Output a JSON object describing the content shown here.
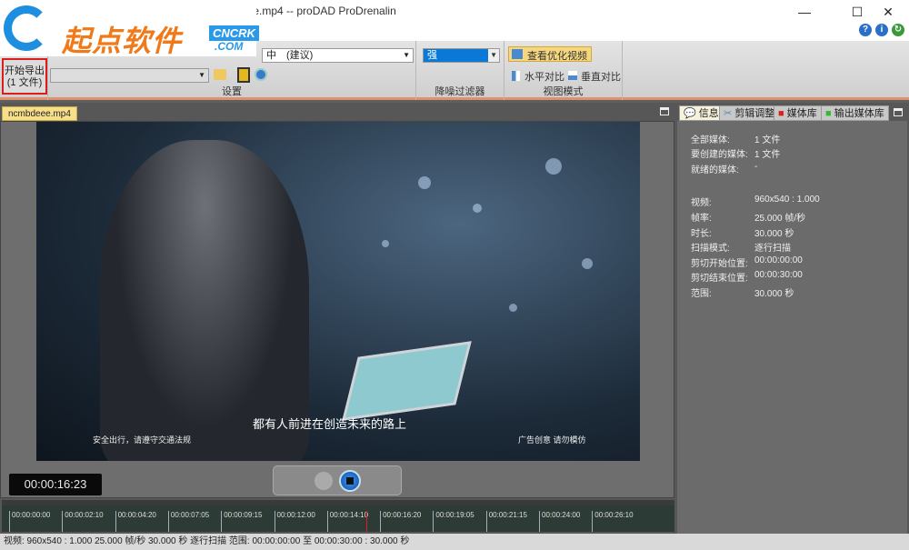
{
  "window": {
    "title": "eee.mp4 -- proDAD ProDrenalin",
    "minimize": "—",
    "maximize": "☐",
    "close": "✕",
    "help": "?",
    "info": "i"
  },
  "watermark": {
    "text": "起点软件",
    "brand": "CNCRK",
    ".com": ".COM"
  },
  "ribbon": {
    "export_label": "开始导出",
    "export_count": "(1 文件)",
    "quality_value": "中　(建议)",
    "path_value": "",
    "settings_label": "设置",
    "denoise_value": "强",
    "denoise_label": "降噪过滤器",
    "view_optimized": "查看优化视频",
    "horizontal": "水平对比",
    "vertical": "垂直对比",
    "view_label": "视图模式"
  },
  "file_tab": "ncmbdeee.mp4",
  "video": {
    "subtitle": "都有人前进在创造未来的路上",
    "left_caption": "安全出行，请遵守交通法规",
    "right_caption": "广告创意 请勿模仿"
  },
  "timecode": "00:00:16:23",
  "timeline": {
    "ticks": [
      "00:00:00:00",
      "00:00:02:10",
      "00:00:04:20",
      "00:00:07:05",
      "00:00:09:15",
      "00:00:12:00",
      "00:00:14:10",
      "00:00:16:20",
      "00:00:19:05",
      "00:00:21:15",
      "00:00:24:00",
      "00:00:26:10"
    ],
    "playhead_fraction": 0.562
  },
  "status": "视频: 960x540 : 1.000   25.000 帧/秒   30.000 秒   逐行扫描   范围: 00:00:00:00 至 00:00:30:00 : 30.000 秒",
  "right_panel": {
    "tabs": [
      "信息",
      "剪辑调整",
      "媒体库",
      "输出媒体库"
    ],
    "rows": [
      {
        "label": "全部媒体:",
        "value": "1 文件"
      },
      {
        "label": "要创建的媒体:",
        "value": "1 文件"
      },
      {
        "label": "就绪的媒体:",
        "value": "-"
      },
      {
        "label": "视频:",
        "value": "960x540 : 1.000"
      },
      {
        "label": "帧率:",
        "value": "25.000 帧/秒"
      },
      {
        "label": "时长:",
        "value": "30.000 秒"
      },
      {
        "label": "扫描模式:",
        "value": "逐行扫描"
      },
      {
        "label": "剪切开始位置:",
        "value": "00:00:00:00"
      },
      {
        "label": "剪切结束位置:",
        "value": "00:00:30:00"
      },
      {
        "label": "范围:",
        "value": "30.000 秒"
      }
    ]
  }
}
